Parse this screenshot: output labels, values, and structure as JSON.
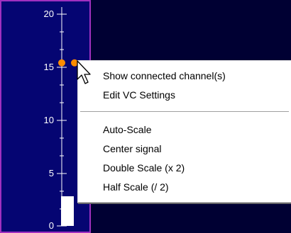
{
  "meter": {
    "tick_labels": [
      "20",
      "15",
      "10",
      "5",
      "0"
    ],
    "level": 2.8,
    "marker_value": 15.4,
    "axis_max": 20
  },
  "context_menu": {
    "items": [
      {
        "label": "Show connected channel(s)"
      },
      {
        "label": "Edit VC Settings"
      },
      {
        "label": "Auto-Scale"
      },
      {
        "label": "Center signal"
      },
      {
        "label": "Double Scale (x 2)"
      },
      {
        "label": "Half Scale (/ 2)"
      }
    ]
  },
  "colors": {
    "panel_bg": "#050572",
    "panel_border": "#a030c0",
    "marker": "#ff8c00",
    "background": "#000033"
  }
}
